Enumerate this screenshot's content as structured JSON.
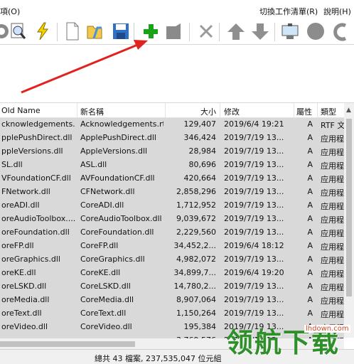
{
  "menu": {
    "left": "項(O)",
    "worklist": "切換工作清單(R)",
    "help": "說明(H)"
  },
  "toolbar": {
    "items": [
      {
        "name": "undo-circle-icon"
      },
      {
        "name": "find-icon"
      },
      {
        "name": "lightning-icon"
      },
      {
        "name": "new-file-icon"
      },
      {
        "name": "open-folder-icon"
      },
      {
        "name": "save-icon"
      },
      {
        "name": "add-icon"
      },
      {
        "name": "tag-icon"
      },
      {
        "name": "delete-x-icon"
      },
      {
        "name": "move-up-icon"
      },
      {
        "name": "move-down-icon"
      },
      {
        "name": "display-icon"
      },
      {
        "name": "stop-circle-icon"
      },
      {
        "name": "redo-icon"
      }
    ]
  },
  "columns": {
    "old_name": "Old Name",
    "new_name": "新名稱",
    "size": "大小",
    "modified": "修改",
    "attr": "屬性",
    "type": "類型"
  },
  "rows": [
    {
      "old": "cknowledgements...",
      "new": "Acknowledgements.rtf",
      "size": "129,407",
      "date": "2019/6/4  19:21",
      "attr": "A",
      "type": "RTF 文"
    },
    {
      "old": "pplePushDirect.dll",
      "new": "ApplePushDirect.dll",
      "size": "346,424",
      "date": "2019/7/19  13...",
      "attr": "A",
      "type": "应用程"
    },
    {
      "old": "ppleVersions.dll",
      "new": "AppleVersions.dll",
      "size": "28,984",
      "date": "2019/7/19  13...",
      "attr": "A",
      "type": "应用程"
    },
    {
      "old": "SL.dll",
      "new": "ASL.dll",
      "size": "80,696",
      "date": "2019/7/19  13...",
      "attr": "A",
      "type": "应用程"
    },
    {
      "old": "VFoundationCF.dll",
      "new": "AVFoundationCF.dll",
      "size": "420,664",
      "date": "2019/7/19  13...",
      "attr": "A",
      "type": "应用程"
    },
    {
      "old": "FNetwork.dll",
      "new": "CFNetwork.dll",
      "size": "2,858,296",
      "date": "2019/7/19  13...",
      "attr": "A",
      "type": "应用程"
    },
    {
      "old": "oreADI.dll",
      "new": "CoreADI.dll",
      "size": "1,712,952",
      "date": "2019/7/19  13...",
      "attr": "A",
      "type": "应用程"
    },
    {
      "old": "oreAudioToolbox....",
      "new": "CoreAudioToolbox.dll",
      "size": "9,039,672",
      "date": "2019/7/19  13...",
      "attr": "A",
      "type": "应用程"
    },
    {
      "old": "oreFoundation.dll",
      "new": "CoreFoundation.dll",
      "size": "2,229,560",
      "date": "2019/7/19  13...",
      "attr": "A",
      "type": "应用程"
    },
    {
      "old": "oreFP.dll",
      "new": "CoreFP.dll",
      "size": "34,452,2...",
      "date": "2019/6/4  18:12",
      "attr": "A",
      "type": "应用程"
    },
    {
      "old": "oreGraphics.dll",
      "new": "CoreGraphics.dll",
      "size": "4,982,072",
      "date": "2019/7/19  13...",
      "attr": "A",
      "type": "应用程"
    },
    {
      "old": "oreKE.dll",
      "new": "CoreKE.dll",
      "size": "34,899,7...",
      "date": "2019/6/4  19:20",
      "attr": "A",
      "type": "应用程"
    },
    {
      "old": "oreLSKD.dll",
      "new": "CoreLSKD.dll",
      "size": "14,780,2...",
      "date": "2019/7/19  13...",
      "attr": "A",
      "type": "应用程"
    },
    {
      "old": "oreMedia.dll",
      "new": "CoreMedia.dll",
      "size": "8,907,064",
      "date": "2019/7/19  13...",
      "attr": "A",
      "type": "应用程"
    },
    {
      "old": "oreText.dll",
      "new": "CoreText.dll",
      "size": "1,150,264",
      "date": "2019/7/19  13...",
      "attr": "A",
      "type": "应用程"
    },
    {
      "old": "oreVideo.dll",
      "new": "CoreVideo.dll",
      "size": "195,384",
      "date": "2019/7/19  13...",
      "attr": "A",
      "type": "应用程"
    },
    {
      "old": "...",
      "new": "...",
      "size": "3,769,576",
      "date": "2019/7/19  13...",
      "attr": "A",
      "type": "应用程"
    }
  ],
  "status": "總共 43 檔案, 237,535,047 位元組",
  "watermark": {
    "text": "领航下载",
    "url": "lhdown.com"
  },
  "colors": {
    "arrow": "#e0231f",
    "watermark": "#2f8f2a",
    "selected_row_bg": "#d9d9d9"
  }
}
